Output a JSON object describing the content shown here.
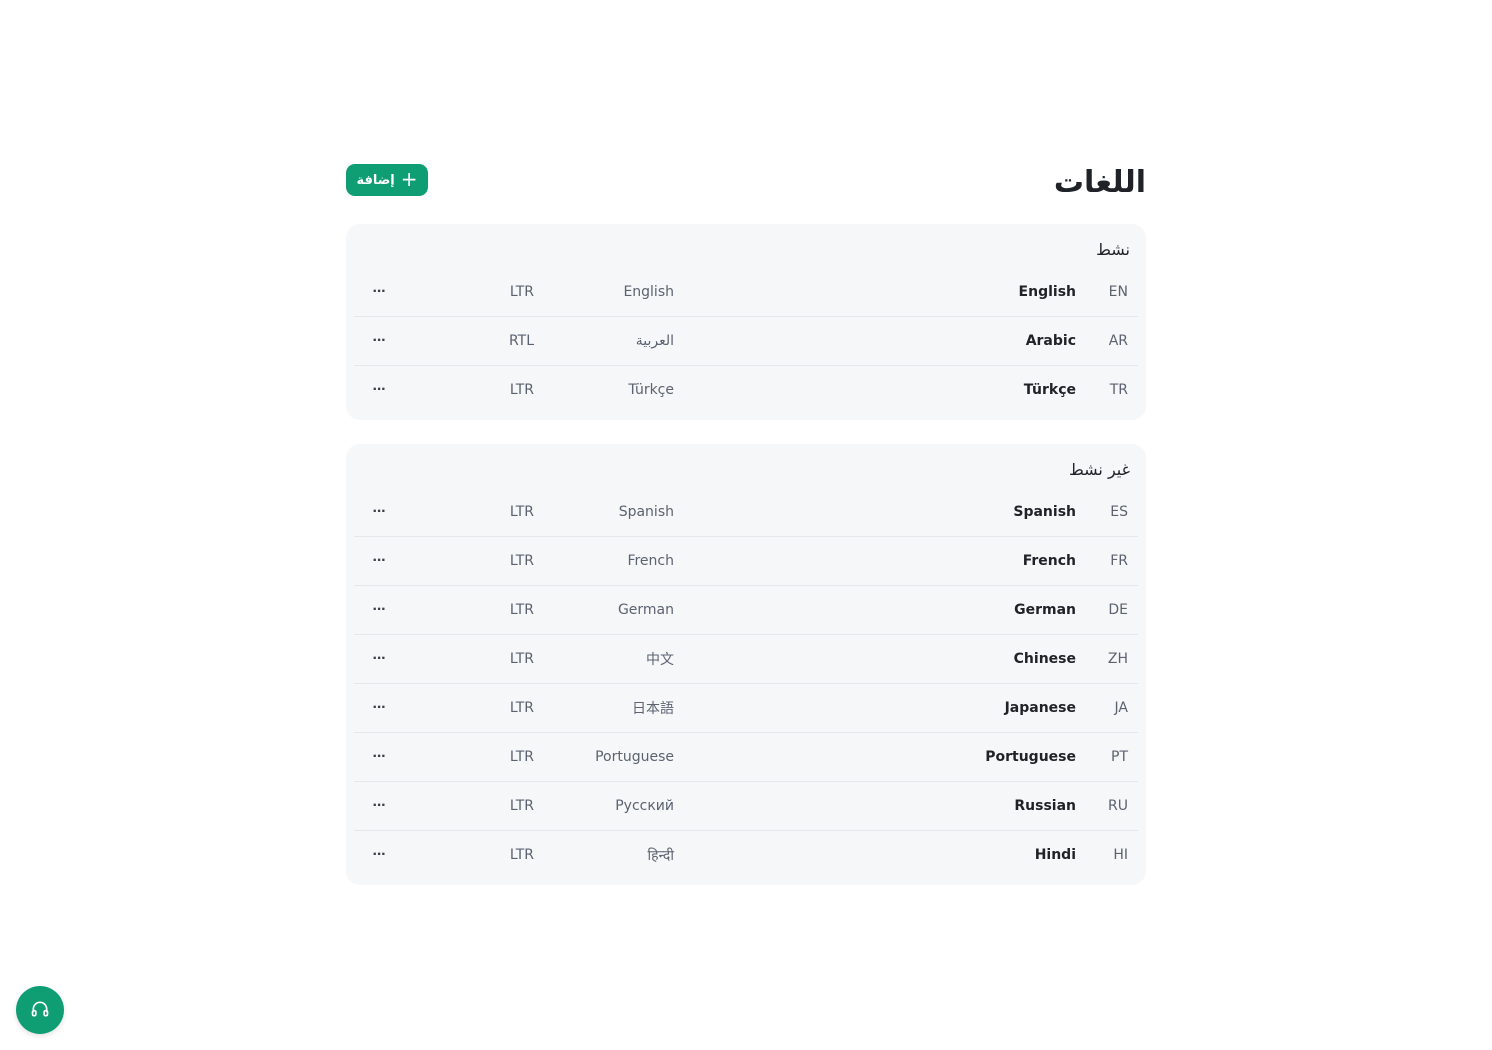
{
  "page": {
    "title": "اللغات",
    "add_label": "إضافة"
  },
  "sections": {
    "active": {
      "title": "نشط",
      "rows": [
        {
          "code": "EN",
          "name": "English",
          "native": "English",
          "dir": "LTR"
        },
        {
          "code": "AR",
          "name": "Arabic",
          "native": "العربية",
          "dir": "RTL"
        },
        {
          "code": "TR",
          "name": "Türkçe",
          "native": "Türkçe",
          "dir": "LTR"
        }
      ]
    },
    "inactive": {
      "title": "غير نشط",
      "rows": [
        {
          "code": "ES",
          "name": "Spanish",
          "native": "Spanish",
          "dir": "LTR"
        },
        {
          "code": "FR",
          "name": "French",
          "native": "French",
          "dir": "LTR"
        },
        {
          "code": "DE",
          "name": "German",
          "native": "German",
          "dir": "LTR"
        },
        {
          "code": "ZH",
          "name": "Chinese",
          "native": "中文",
          "dir": "LTR"
        },
        {
          "code": "JA",
          "name": "Japanese",
          "native": "日本語",
          "dir": "LTR"
        },
        {
          "code": "PT",
          "name": "Portuguese",
          "native": "Portuguese",
          "dir": "LTR"
        },
        {
          "code": "RU",
          "name": "Russian",
          "native": "Русский",
          "dir": "LTR"
        },
        {
          "code": "HI",
          "name": "Hindi",
          "native": "हिन्दी",
          "dir": "LTR"
        }
      ]
    }
  },
  "icons": {
    "more": "more-horizontal-icon",
    "add": "plus-icon",
    "support": "headphones-icon"
  },
  "colors": {
    "accent": "#0f9d73",
    "section_bg": "#f6f7f8"
  }
}
